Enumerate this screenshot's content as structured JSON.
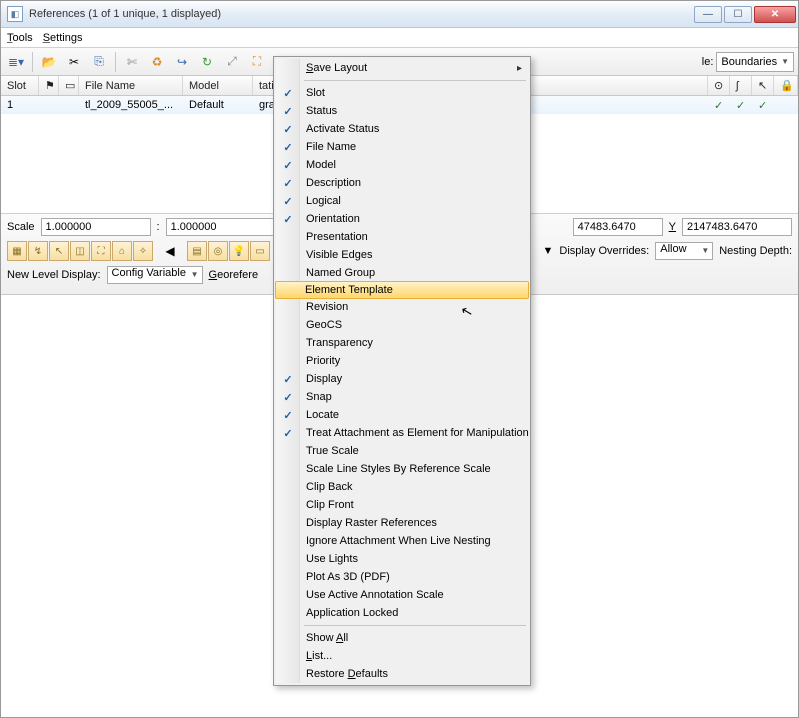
{
  "window": {
    "title": "References (1 of 1 unique, 1 displayed)"
  },
  "menubar": {
    "tools": "Tools",
    "settings": "Settings"
  },
  "toolbar": {
    "hilite_label": "le:",
    "hilite_value": "Boundaries"
  },
  "columns": {
    "slot": "Slot",
    "filename": "File Name",
    "model": "Model",
    "tation": "tation"
  },
  "row1": {
    "slot": "1",
    "filename": "tl_2009_55005_...",
    "model": "Default",
    "tation": "graphic - Repro..."
  },
  "info": {
    "scale_label": "Scale",
    "scale_a": "1.000000",
    "scale_colon": ":",
    "scale_b": "1.000000",
    "coord_a": "47483.6470",
    "y_label": "Y",
    "coord_b": "2147483.6470",
    "newlevel": "New Level Display:",
    "config": "Config Variable",
    "georef": "Georefere",
    "dispover": "Display Overrides:",
    "allow": "Allow",
    "nesting": "Nesting Depth:"
  },
  "ctx": {
    "save": "Save Layout",
    "slot": "Slot",
    "status": "Status",
    "activate": "Activate Status",
    "filename": "File Name",
    "model": "Model",
    "desc": "Description",
    "logical": "Logical",
    "orient": "Orientation",
    "present": "Presentation",
    "edges": "Visible Edges",
    "named": "Named Group",
    "etemplate": "Element Template",
    "rev": "Revision",
    "geocs": "GeoCS",
    "transp": "Transparency",
    "prio": "Priority",
    "display": "Display",
    "snap": "Snap",
    "locate": "Locate",
    "treat": "Treat Attachment as Element for Manipulation",
    "truescale": "True Scale",
    "scaleline": "Scale Line Styles By Reference Scale",
    "clipback": "Clip Back",
    "clipfront": "Clip Front",
    "raster": "Display Raster References",
    "ignore": "Ignore Attachment When Live Nesting",
    "lights": "Use Lights",
    "plot3d": "Plot As 3D (PDF)",
    "annot": "Use Active Annotation Scale",
    "applock": "Application Locked",
    "showall": "Show All",
    "list": "List...",
    "restore": "Restore Defaults"
  }
}
